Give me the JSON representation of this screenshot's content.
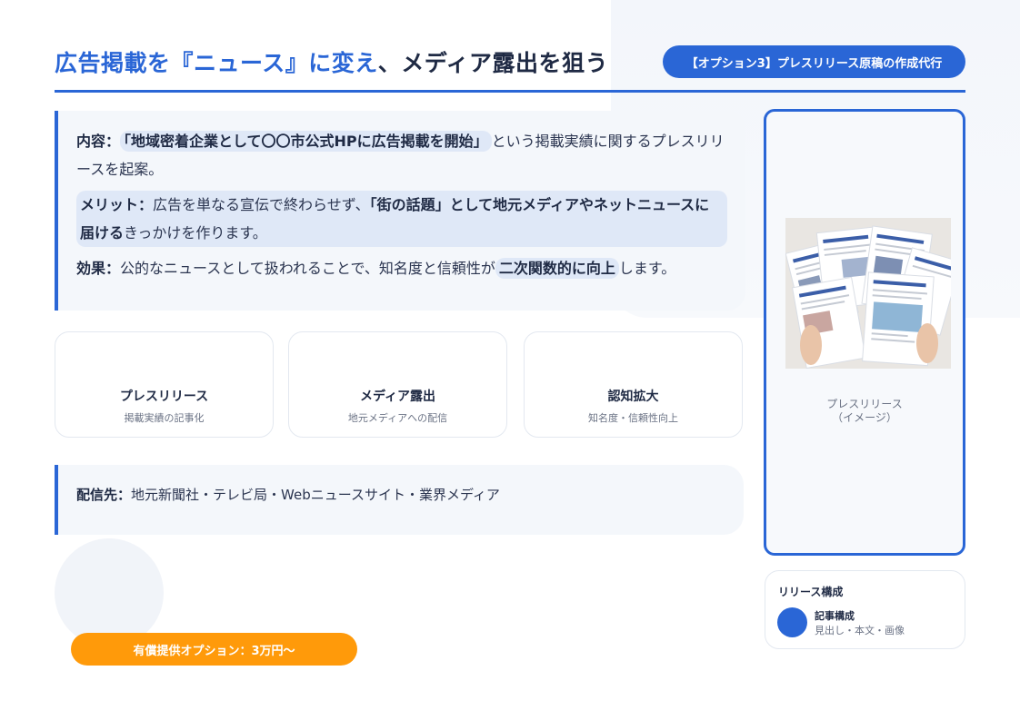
{
  "header": {
    "title_accent": "広告掲載を『ニュース』に変え",
    "title_rest": "、メディア露出を狙う",
    "option_badge": "【オプション3】プレスリリース原稿の作成代行"
  },
  "content": {
    "naiyou": {
      "label": "内容：",
      "highlight": "「地域密着企業として〇〇市公式HPに広告掲載を開始」",
      "text": "という掲載実績に関するプレスリリースを起案。"
    },
    "merit": {
      "label": "メリット：",
      "text1": "広告を単なる宣伝で終わらせず、",
      "highlight": "「街の話題」として地元メディアやネットニュースに届ける",
      "text2": "きっかけを作ります。"
    },
    "kouka": {
      "label": "効果：",
      "text1": "公的なニュースとして扱われることで、知名度と信頼性が",
      "highlight": "二次関数的に向上",
      "text2": "します。"
    }
  },
  "cards": [
    {
      "title": "プレスリリース",
      "sub": "掲載実績の記事化"
    },
    {
      "title": "メディア露出",
      "sub": "地元メディアへの配信"
    },
    {
      "title": "認知拡大",
      "sub": "知名度・信頼性向上"
    }
  ],
  "distribution": {
    "label": "配信先：",
    "text": "地元新聞社・テレビ局・Webニュースサイト・業界メディア"
  },
  "price": "有償提供オプション：3万円〜",
  "image_panel": {
    "caption_line1": "プレスリリース",
    "caption_line2": "（イメージ）"
  },
  "release": {
    "title": "リリース構成",
    "item_title": "記事構成",
    "item_sub": "見出し・本文・画像"
  },
  "colors": {
    "accent": "#2a66d6",
    "orange": "#ff9a0a",
    "text_dark": "#1f2a44"
  }
}
